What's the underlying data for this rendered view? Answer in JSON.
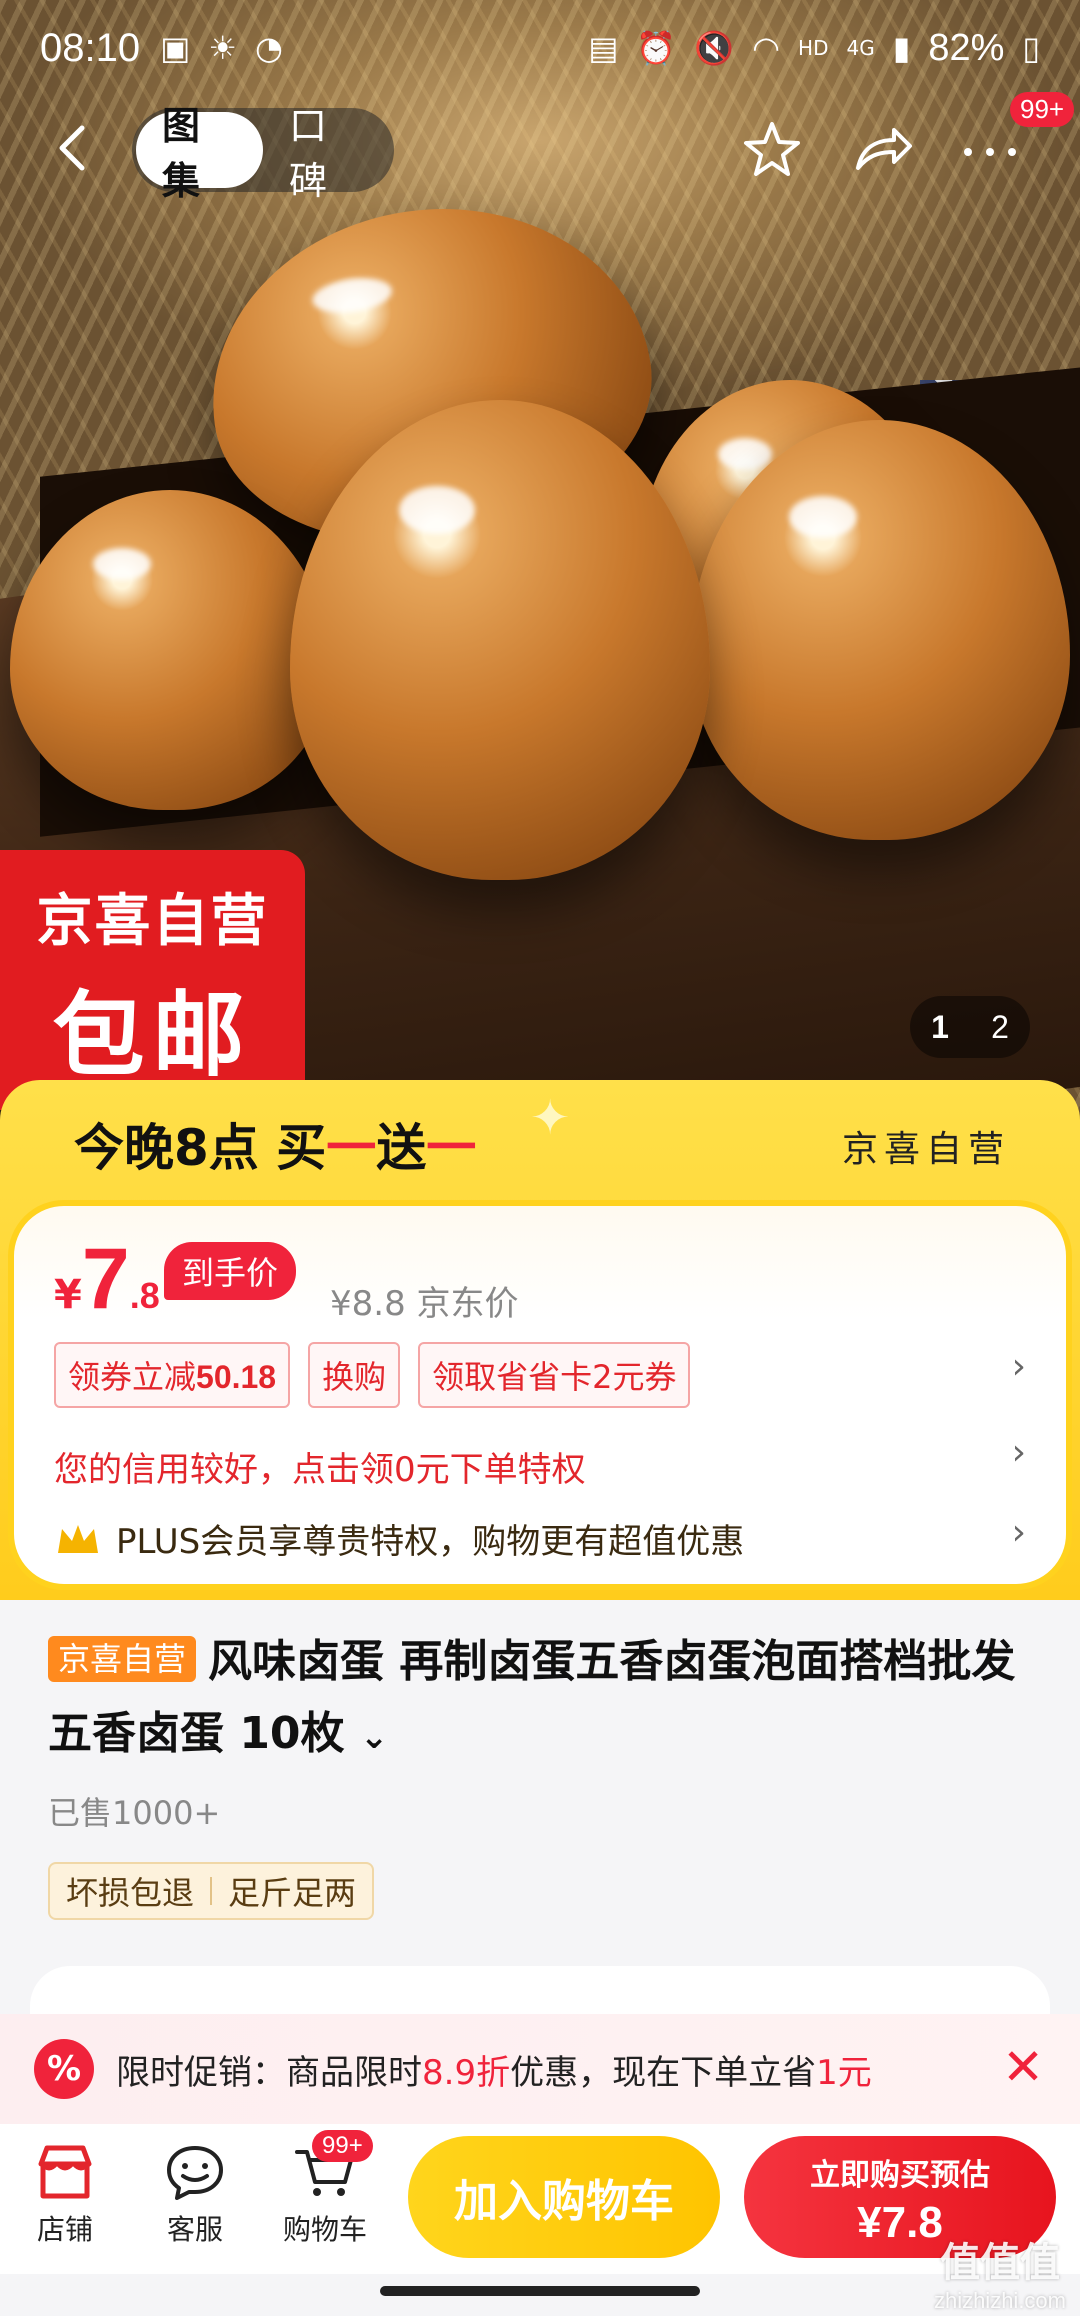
{
  "status_bar": {
    "time": "08:10",
    "network": "4G",
    "hd": "HD",
    "battery": "82%"
  },
  "nav": {
    "tabs": [
      {
        "label": "图集",
        "active": true
      },
      {
        "label": "口碑",
        "active": false
      }
    ],
    "more_badge": "99+"
  },
  "hero": {
    "sticker_line1": "京喜自营",
    "sticker_line2": "包邮",
    "pager_current": "1",
    "pager_total": "2"
  },
  "promo": {
    "headline_prefix": "今晚8点 买",
    "headline_red1": "一",
    "headline_mid": "送",
    "headline_red2": "一",
    "side_label": "京喜自营"
  },
  "price": {
    "currency": "¥",
    "integer": "7",
    "decimal": ".8",
    "tag": "到手价",
    "jd_price": "¥8.8 京东价",
    "coupons": [
      {
        "label": "领券立减",
        "value": "50.18"
      },
      {
        "label": "换购",
        "value": ""
      },
      {
        "label": "领取省省卡2元券",
        "value": ""
      }
    ],
    "credit_text": "您的信用较好，点击领0元下单特权",
    "plus_text": "PLUS会员享尊贵特权，购物更有超值优惠"
  },
  "product": {
    "tag": "京喜自营",
    "title": "风味卤蛋 再制卤蛋五香卤蛋泡面搭档批发 五香卤蛋 10枚",
    "sold": "已售1000+",
    "services": [
      "坏损包退",
      "足斤足两"
    ]
  },
  "promo_strip": {
    "icon": "%",
    "text_a": "限时促销：商品限时",
    "text_red1": "8.9折",
    "text_b": "优惠，现在下单立省",
    "text_red2": "1元"
  },
  "bottom_bar": {
    "store": "店铺",
    "service": "客服",
    "cart": "购物车",
    "cart_badge": "99+",
    "add_cart": "加入购物车",
    "buy_line1": "立即购买预估",
    "buy_line2": "¥7.8"
  },
  "watermark": {
    "title": "值值值",
    "url": "zhizhizhi.com"
  },
  "colors": {
    "accent_red": "#f0233b",
    "accent_yellow": "#ffcc1c",
    "tag_orange": "#ff8a1e"
  }
}
